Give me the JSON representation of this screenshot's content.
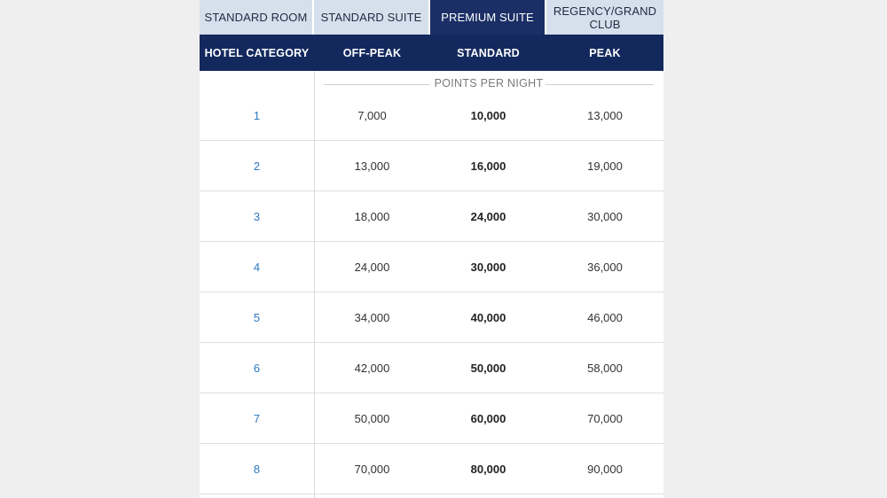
{
  "tabs": [
    {
      "label": "STANDARD ROOM",
      "active": false
    },
    {
      "label": "STANDARD SUITE",
      "active": false
    },
    {
      "label": "PREMIUM SUITE",
      "active": true
    },
    {
      "label": "REGENCY/GRAND CLUB",
      "active": false
    }
  ],
  "table": {
    "headers": {
      "category": "HOTEL CATEGORY",
      "off_peak": "OFF-PEAK",
      "standard": "STANDARD",
      "peak": "PEAK"
    },
    "subheader": "POINTS PER NIGHT",
    "rows": [
      {
        "category": "1",
        "off_peak": "7,000",
        "standard": "10,000",
        "peak": "13,000"
      },
      {
        "category": "2",
        "off_peak": "13,000",
        "standard": "16,000",
        "peak": "19,000"
      },
      {
        "category": "3",
        "off_peak": "18,000",
        "standard": "24,000",
        "peak": "30,000"
      },
      {
        "category": "4",
        "off_peak": "24,000",
        "standard": "30,000",
        "peak": "36,000"
      },
      {
        "category": "5",
        "off_peak": "34,000",
        "standard": "40,000",
        "peak": "46,000"
      },
      {
        "category": "6",
        "off_peak": "42,000",
        "standard": "50,000",
        "peak": "58,000"
      },
      {
        "category": "7",
        "off_peak": "50,000",
        "standard": "60,000",
        "peak": "70,000"
      },
      {
        "category": "8",
        "off_peak": "70,000",
        "standard": "80,000",
        "peak": "90,000"
      }
    ]
  },
  "colors": {
    "header_navy": "#13295e",
    "active_tab": "#1b2f66",
    "inactive_tab": "#d6e0ec",
    "category_link": "#2f79c0"
  }
}
